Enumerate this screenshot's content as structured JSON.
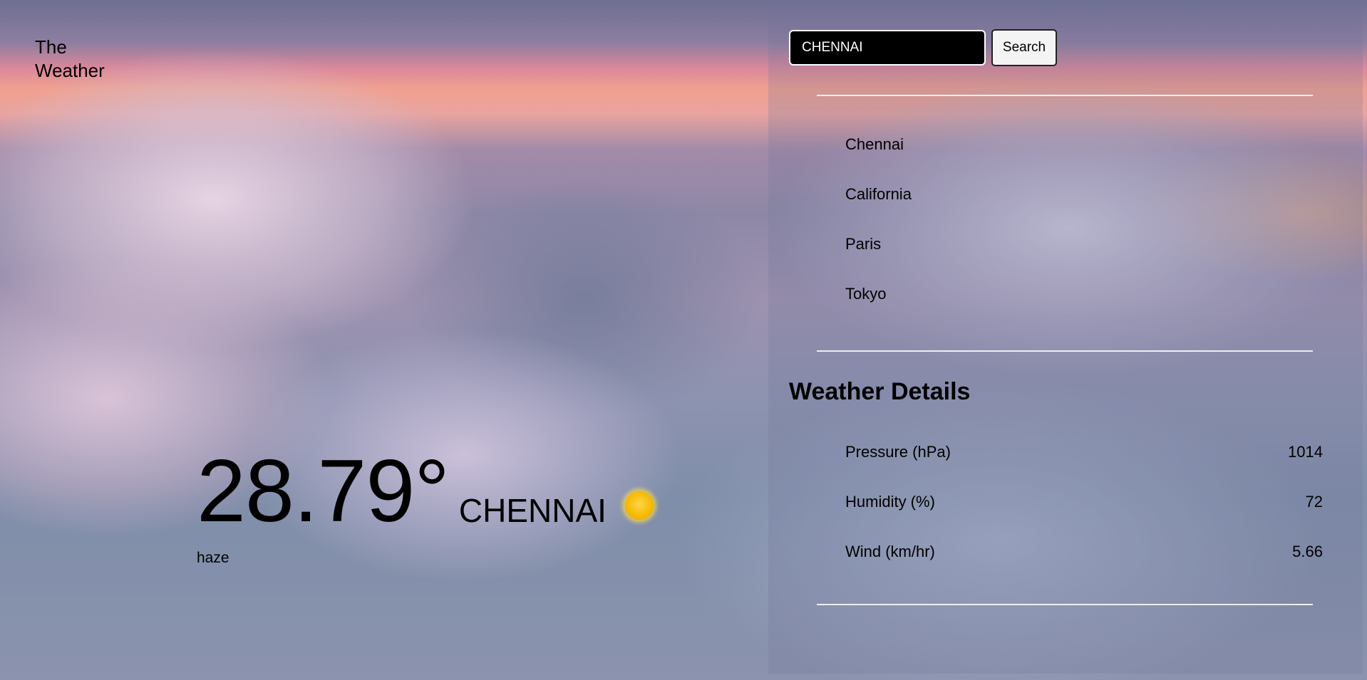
{
  "brand": {
    "line1": "The",
    "line2": "Weather"
  },
  "current": {
    "temperature": "28.79°",
    "city": "CHENNAI",
    "condition": "haze",
    "icon": "sun-icon"
  },
  "search": {
    "value": "CHENNAI",
    "button_label": "Search"
  },
  "locations": [
    "Chennai",
    "California",
    "Paris",
    "Tokyo"
  ],
  "details": {
    "title": "Weather Details",
    "rows": [
      {
        "label": "Pressure (hPa)",
        "value": "1014"
      },
      {
        "label": "Humidity (%)",
        "value": "72"
      },
      {
        "label": "Wind (km/hr)",
        "value": "5.66"
      }
    ]
  },
  "colors": {
    "input_bg": "#000000",
    "sun": "#f6b900"
  }
}
